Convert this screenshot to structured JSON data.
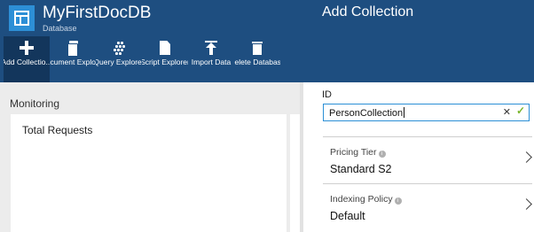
{
  "left_blade": {
    "title": "MyFirstDocDB",
    "subtitle": "Database",
    "toolbar": [
      {
        "label": "Add Collectio...",
        "icon": "plus-icon",
        "active": true
      },
      {
        "label": "Document Explorer",
        "icon": "document-icon"
      },
      {
        "label": "Query Explorer",
        "icon": "query-icon"
      },
      {
        "label": "Script Explorer",
        "icon": "script-icon"
      },
      {
        "label": "Import Data",
        "icon": "import-icon"
      },
      {
        "label": "Delete Database",
        "icon": "trash-icon"
      }
    ],
    "monitoring_label": "Monitoring",
    "tile_title": "Total Requests"
  },
  "right_blade": {
    "title": "Add Collection",
    "id_label": "ID",
    "id_value": "PersonCollection",
    "clear_glyph": "✕",
    "check_glyph": "✓",
    "pricing_tier": {
      "label": "Pricing Tier",
      "value": "Standard S2"
    },
    "indexing_policy": {
      "label": "Indexing Policy",
      "value": "Default"
    }
  },
  "colors": {
    "header": "#1e4e80",
    "accent": "#2b8fd6",
    "valid": "#7ab52d"
  }
}
